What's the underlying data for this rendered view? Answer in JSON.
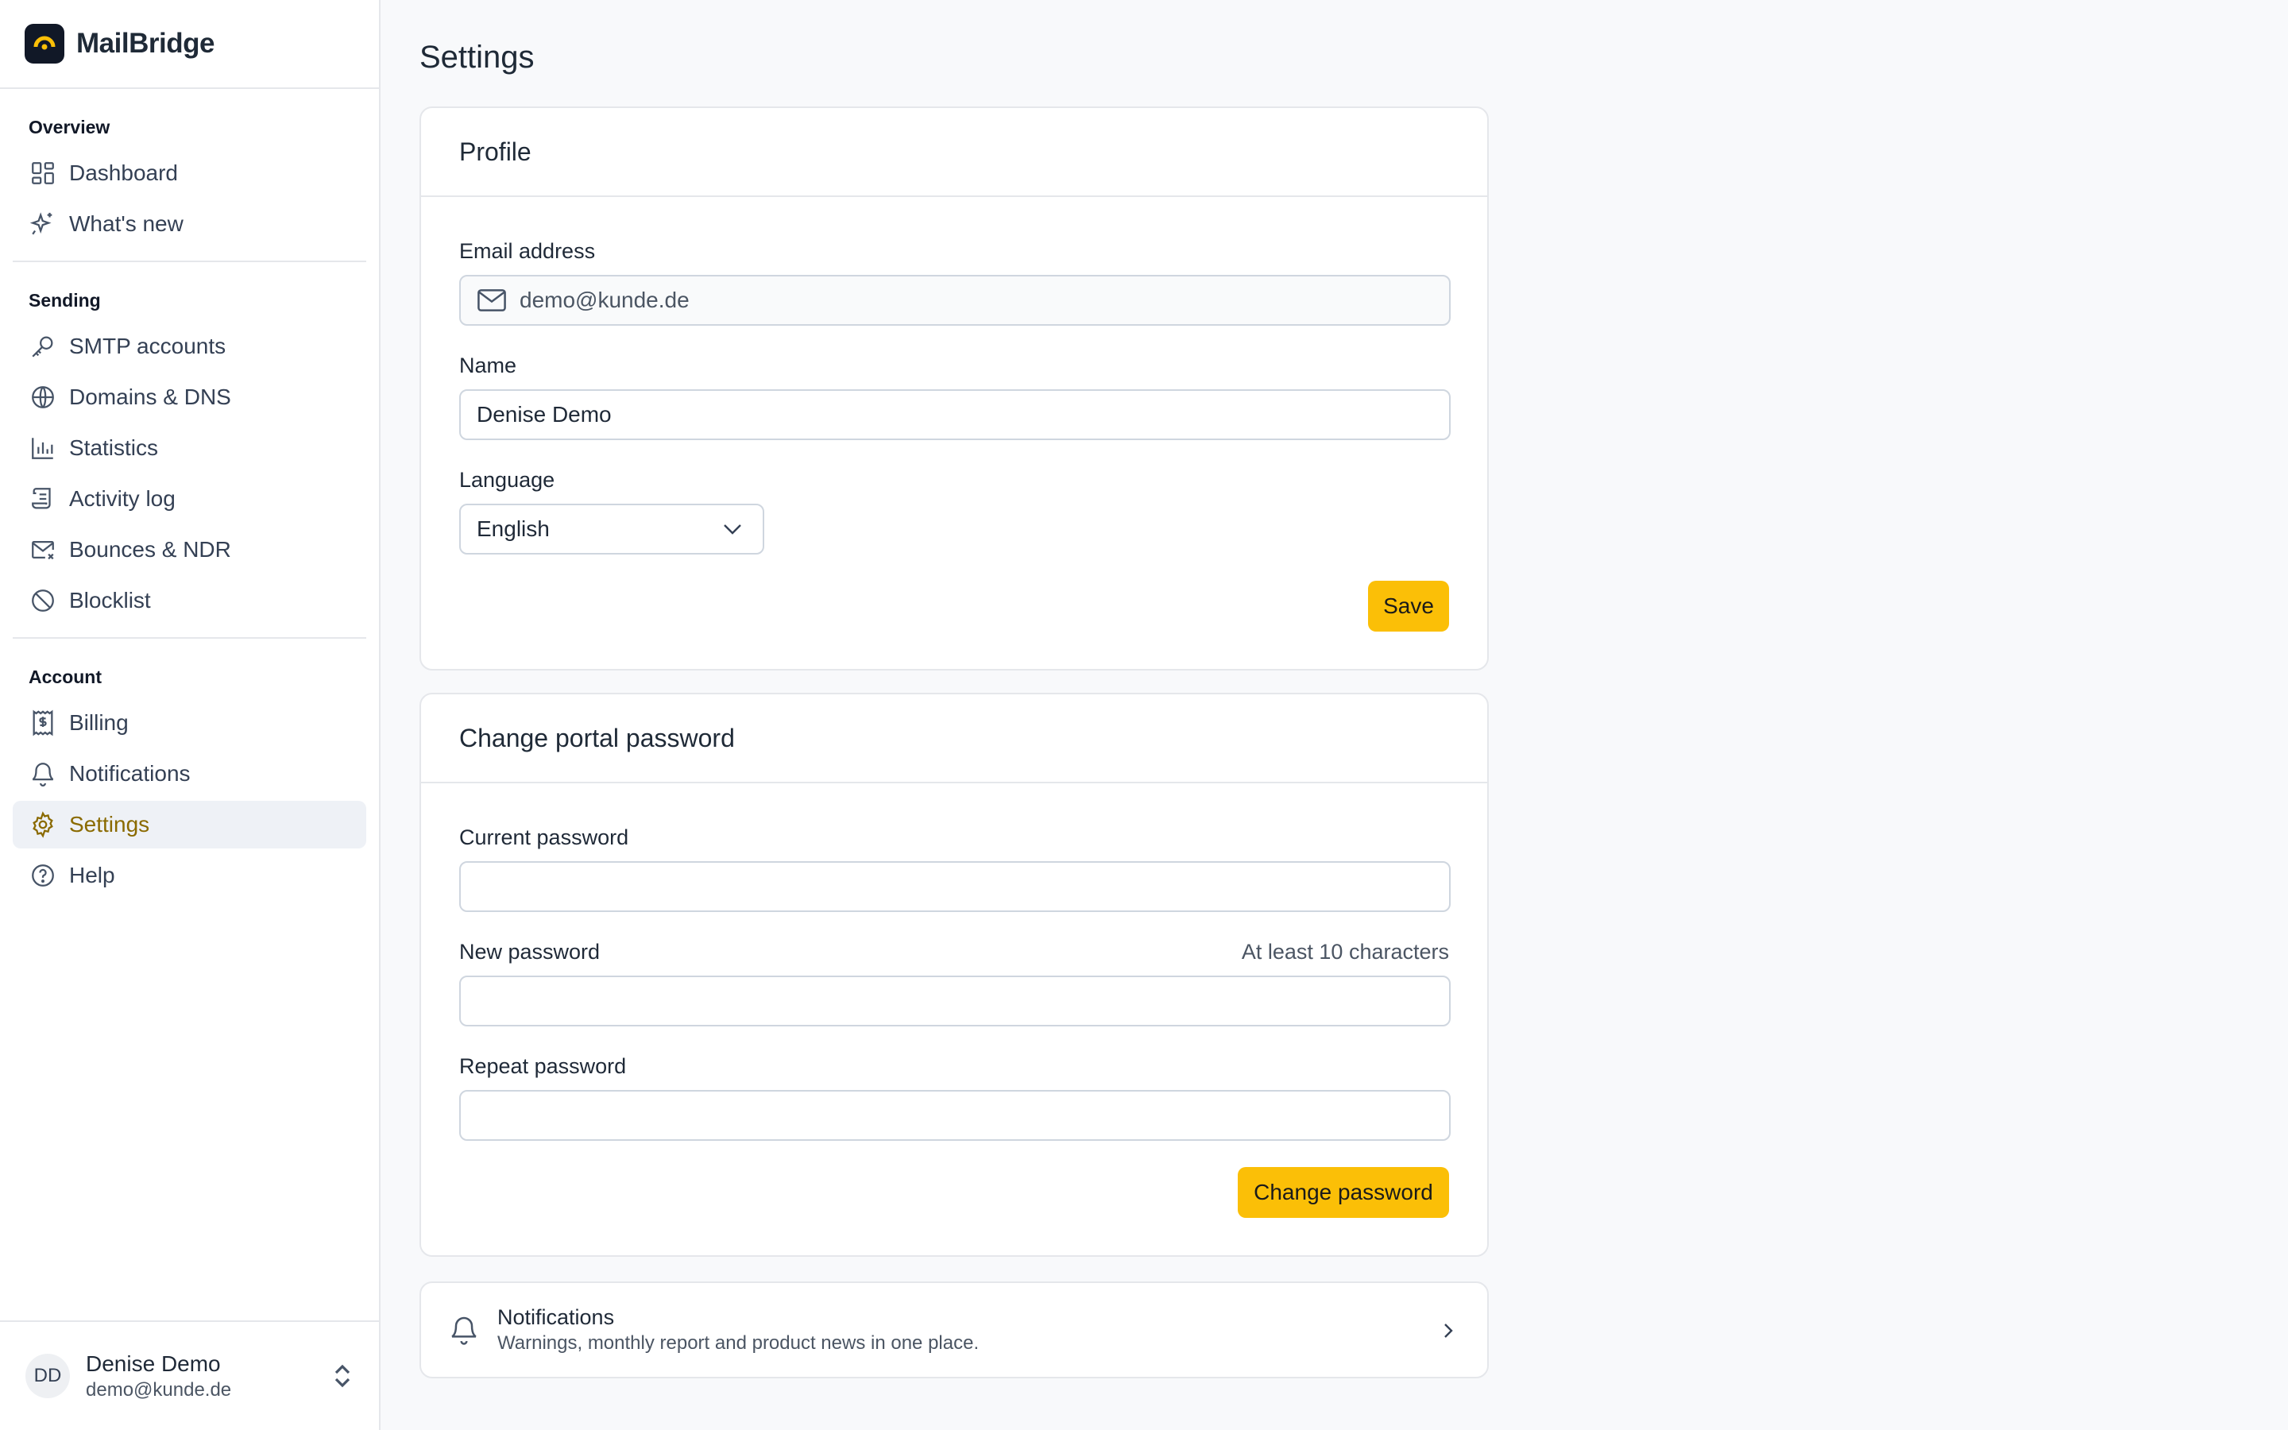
{
  "app": {
    "name": "MailBridge"
  },
  "sidebar": {
    "sections": [
      {
        "title": "Overview",
        "items": [
          {
            "label": "Dashboard",
            "icon": "dashboard-icon"
          },
          {
            "label": "What's new",
            "icon": "sparkles-icon"
          }
        ]
      },
      {
        "title": "Sending",
        "items": [
          {
            "label": "SMTP accounts",
            "icon": "key-icon"
          },
          {
            "label": "Domains & DNS",
            "icon": "globe-icon"
          },
          {
            "label": "Statistics",
            "icon": "bar-chart-icon"
          },
          {
            "label": "Activity log",
            "icon": "scroll-icon"
          },
          {
            "label": "Bounces & NDR",
            "icon": "mail-x-icon"
          },
          {
            "label": "Blocklist",
            "icon": "ban-icon"
          }
        ]
      },
      {
        "title": "Account",
        "items": [
          {
            "label": "Billing",
            "icon": "receipt-icon"
          },
          {
            "label": "Notifications",
            "icon": "bell-icon"
          },
          {
            "label": "Settings",
            "icon": "gear-icon",
            "active": true
          },
          {
            "label": "Help",
            "icon": "help-circle-icon"
          }
        ]
      }
    ],
    "user": {
      "initials": "DD",
      "name": "Denise Demo",
      "email": "demo@kunde.de"
    }
  },
  "page": {
    "title": "Settings"
  },
  "profile": {
    "title": "Profile",
    "email_label": "Email address",
    "email_value": "demo@kunde.de",
    "name_label": "Name",
    "name_value": "Denise Demo",
    "language_label": "Language",
    "language_value": "English",
    "save_label": "Save"
  },
  "password": {
    "title": "Change portal password",
    "current_label": "Current password",
    "new_label": "New password",
    "new_hint": "At least 10 characters",
    "repeat_label": "Repeat password",
    "submit_label": "Change password"
  },
  "notifications_card": {
    "title": "Notifications",
    "description": "Warnings, monthly report and product news in one place."
  },
  "colors": {
    "accent": "#fbbf07",
    "active_text": "#8a6a00",
    "active_bg": "#eef1f6"
  }
}
